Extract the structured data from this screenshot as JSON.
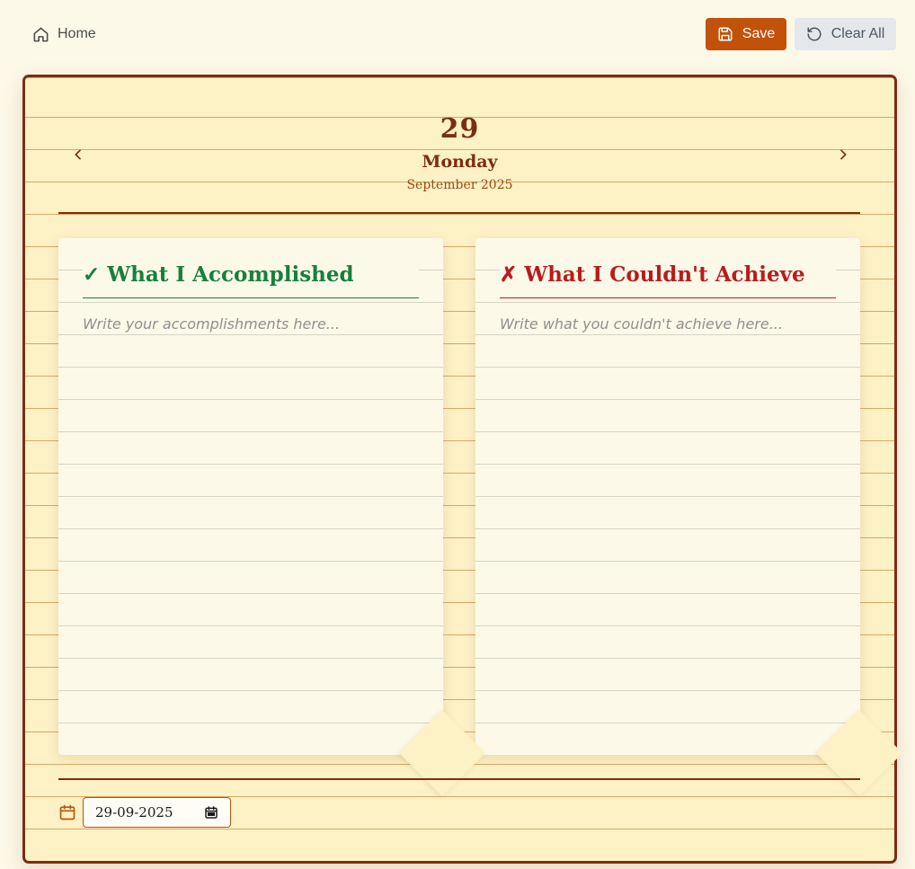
{
  "topbar": {
    "home_label": "Home",
    "save_label": "Save",
    "clear_label": "Clear All"
  },
  "colors": {
    "accent": "#c2510a",
    "border": "#7c2d12",
    "paper": "#fdf1c6",
    "success": "#16803c",
    "danger": "#b91c1c"
  },
  "diary": {
    "day": "29",
    "weekday": "Monday",
    "month_year": "September 2025",
    "accomplished": {
      "title": "✓ What I Accomplished",
      "placeholder": "Write your accomplishments here...",
      "value": ""
    },
    "not_achieved": {
      "title": "✗ What I Couldn't Achieve",
      "placeholder": "Write what you couldn't achieve here...",
      "value": ""
    },
    "date_value": "29-09-2025"
  },
  "icons": {
    "home": "home-icon",
    "save": "save-icon",
    "clear": "rotate-ccw-icon",
    "prev": "chevron-left-icon",
    "next": "chevron-right-icon",
    "calendar": "calendar-icon"
  }
}
